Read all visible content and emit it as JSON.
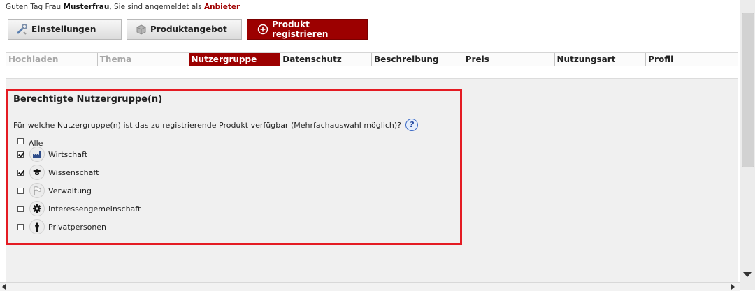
{
  "greeting": {
    "prefix": "Guten Tag Frau ",
    "name": "Musterfrau",
    "middle": ", Sie sind angemeldet als ",
    "role": "Anbieter"
  },
  "topnav": {
    "settings": "Einstellungen",
    "offers": "Produktangebot",
    "register": "Produkt registrieren"
  },
  "steps": [
    "Hochladen",
    "Thema",
    "Nutzergruppe",
    "Datenschutz",
    "Beschreibung",
    "Preis",
    "Nutzungsart",
    "Profil"
  ],
  "panel": {
    "title": "Berechtigte Nutzergruppe(n)",
    "question": "Für welche Nutzergruppe(n) ist das zu registrierende Produkt verfügbar (Mehrfachauswahl möglich)?",
    "help": "?"
  },
  "options": [
    {
      "label": "Alle",
      "checked": false,
      "icon": "none"
    },
    {
      "label": "Wirtschaft",
      "checked": true,
      "icon": "factory-icon"
    },
    {
      "label": "Wissenschaft",
      "checked": true,
      "icon": "graduation-cap-icon"
    },
    {
      "label": "Verwaltung",
      "checked": false,
      "icon": "flag-icon"
    },
    {
      "label": "Interessengemeinschaft",
      "checked": false,
      "icon": "gear-icon"
    },
    {
      "label": "Privatpersonen",
      "checked": false,
      "icon": "person-icon"
    }
  ],
  "colors": {
    "accent": "#9c0000",
    "highlight_border": "#e41b23"
  }
}
